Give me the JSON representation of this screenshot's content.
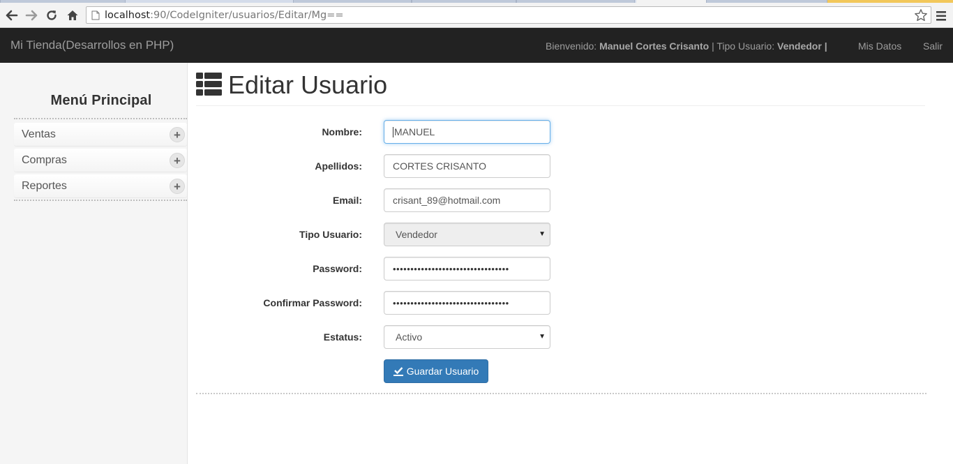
{
  "browser": {
    "url_host": "localhost",
    "url_path": ":90/CodeIgniter/usuarios/Editar/Mg=="
  },
  "navbar": {
    "brand": "Mi Tienda(Desarrollos en PHP)",
    "welcome_prefix": "Bienvenido:",
    "user_name": "Manuel Cortes Crisanto",
    "user_type_prefix": "| Tipo Usuario:",
    "user_type": "Vendedor",
    "user_type_suffix": "|",
    "my_data": "Mis Datos",
    "logout": "Salir"
  },
  "sidebar": {
    "title": "Menú Principal",
    "items": [
      {
        "label": "Ventas"
      },
      {
        "label": "Compras"
      },
      {
        "label": "Reportes"
      }
    ]
  },
  "main": {
    "title": "Editar Usuario",
    "form": {
      "nombre_label": "Nombre:",
      "nombre_value": "MANUEL",
      "apellidos_label": "Apellidos:",
      "apellidos_value": "CORTES CRISANTO",
      "email_label": "Email:",
      "email_value": "crisant_89@hotmail.com",
      "tipo_label": "Tipo Usuario:",
      "tipo_value": "Vendedor",
      "password_label": "Password:",
      "password_value": "•••••••••••••••••••••••••••••••••",
      "confirm_label": "Confirmar Password:",
      "confirm_value": "•••••••••••••••••••••••••••••••••",
      "estatus_label": "Estatus:",
      "estatus_value": "Activo",
      "save_button": "Guardar Usuario"
    }
  },
  "colors": {
    "navbar_bg": "#222222",
    "primary": "#337ab7",
    "focus": "#66afe9"
  }
}
